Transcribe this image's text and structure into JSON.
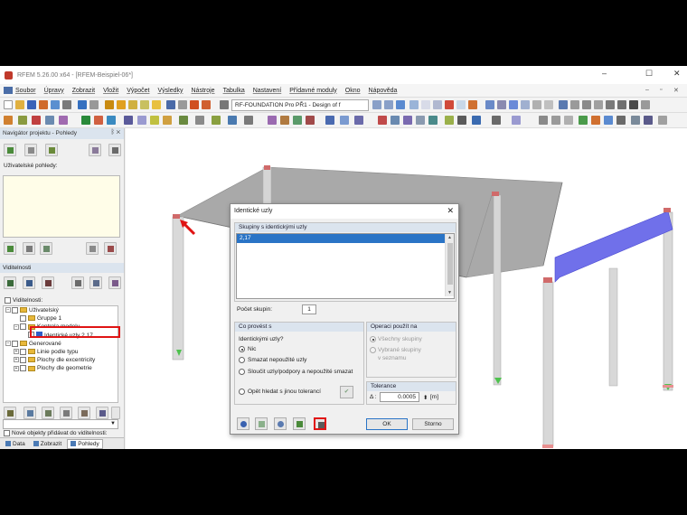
{
  "window": {
    "title": "RFEM 5.26.00 x64 - [RFEM-Beispiel-06*]",
    "controls": [
      "–",
      "☐",
      "✕"
    ]
  },
  "menu": {
    "items": [
      "Soubor",
      "Úpravy",
      "Zobrazit",
      "Vložit",
      "Výpočet",
      "Výsledky",
      "Nástroje",
      "Tabulka",
      "Nastavení",
      "Přídavné moduly",
      "Okno",
      "Nápověda"
    ],
    "controls": [
      "–",
      "▫",
      "✕"
    ]
  },
  "toolbar": {
    "module_combo": "RF-FOUNDATION Pro PŘ1 - Design of f"
  },
  "navigator": {
    "title": "Navigátor projektu - Pohledy",
    "pin": "ᛒ ✕",
    "user_views_label": "Uživatelské pohledy:",
    "visibility_header": "Viditelnosti",
    "visibility_label": "Viditelnosti:",
    "tree": [
      {
        "level": 0,
        "exp": "−",
        "folder": true,
        "label": "Uživatelský"
      },
      {
        "level": 1,
        "exp": "",
        "folder": true,
        "label": "Gruppe 1"
      },
      {
        "level": 1,
        "exp": "−",
        "folder": true,
        "label": "Kontrola modelu"
      },
      {
        "level": 2,
        "exp": "",
        "folder": false,
        "node": true,
        "label": "Identické uzly 2,17"
      },
      {
        "level": 0,
        "exp": "−",
        "folder": true,
        "label": "Generované"
      },
      {
        "level": 1,
        "exp": "+",
        "folder": true,
        "label": "Linie podle typu"
      },
      {
        "level": 1,
        "exp": "+",
        "folder": true,
        "label": "Plochy dle excentricity"
      },
      {
        "level": 1,
        "exp": "+",
        "folder": true,
        "label": "Plochy dle geometrie"
      }
    ],
    "new_objects_label": "Nové objekty přidávat do viditelnosti:",
    "tabs": [
      {
        "label": "Data",
        "active": false
      },
      {
        "label": "Zobrazit",
        "active": false
      },
      {
        "label": "Pohledy",
        "active": true
      }
    ]
  },
  "dialog": {
    "title": "Identické uzly",
    "close": "✕",
    "groups_header": "Skupiny s identickými uzly",
    "groups": [
      "2,17"
    ],
    "group_count_label": "Počet skupin:",
    "group_count": "1",
    "action_header": "Co provést s",
    "identical_nodes_label": "Identickými uzly?",
    "actions": [
      {
        "label": "Nic",
        "selected": true
      },
      {
        "label": "Smazat nepoužité uzly",
        "selected": false
      },
      {
        "label": "Sloučit uzly/podpory a nepoužité smazat",
        "selected": false
      }
    ],
    "apply_header": "Operaci použít na",
    "apply_options": [
      {
        "label": "Všechny skupiny",
        "selected": true
      },
      {
        "label": "Vybrané skupiny",
        "label2": "v seznamu",
        "selected": false
      }
    ],
    "tolerance_header": "Tolerance",
    "tolerance_symbol": "Δ :",
    "tolerance_value": "0.0005",
    "tolerance_unit": "[m]",
    "retry_label": "Opět hledat s jinou tolerancí",
    "ok_label": "OK",
    "cancel_label": "Storno"
  },
  "colors": {
    "accent": "#2a74c6",
    "highlight": "#e01414",
    "selected_member": "#6a6ae8"
  }
}
